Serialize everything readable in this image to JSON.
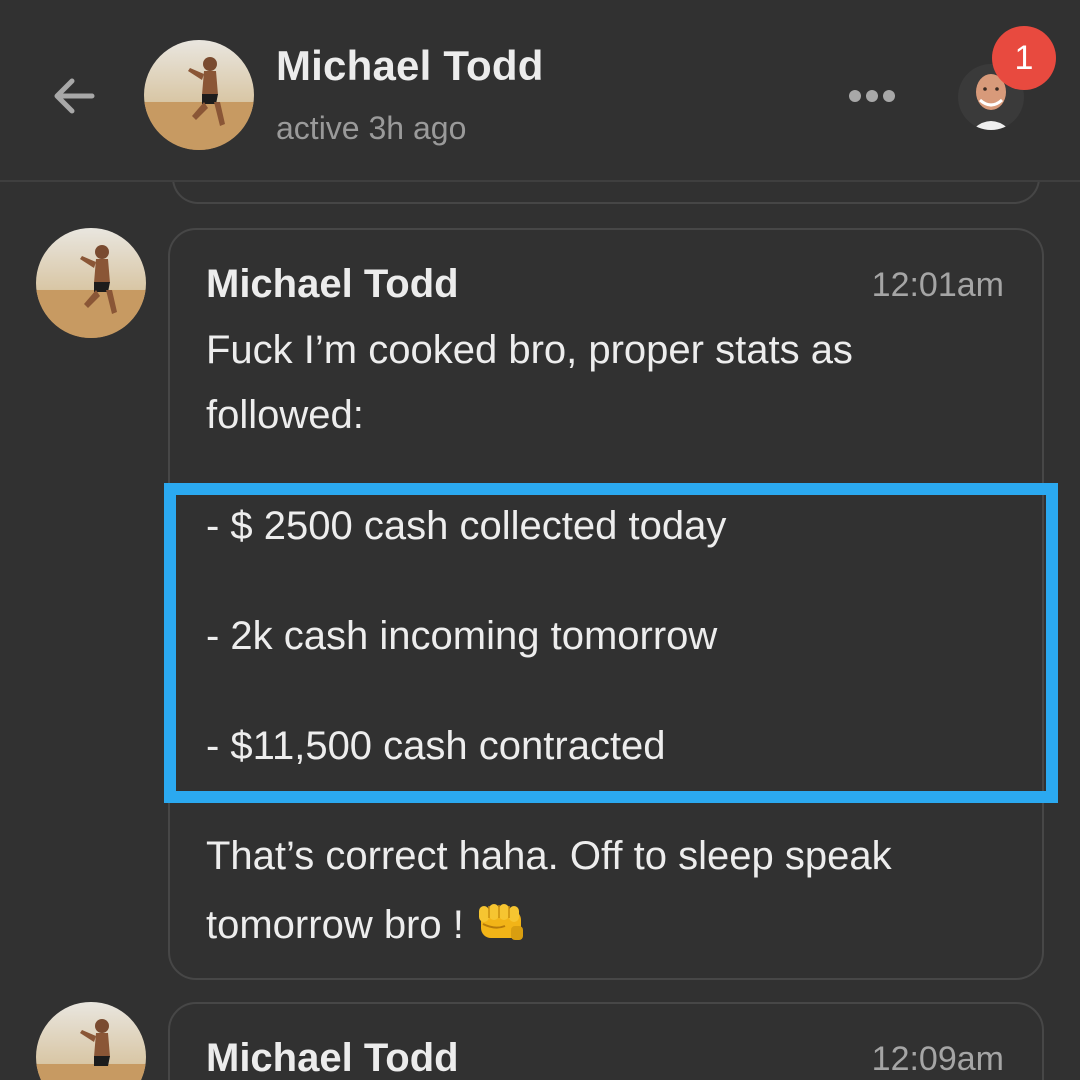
{
  "header": {
    "contact_name": "Michael Todd",
    "status": "active 3h ago",
    "notification_count": "1",
    "back_icon": "arrow-left-icon",
    "more_icon": "more-horizontal-icon"
  },
  "messages": [
    {
      "sender": "Michael Todd",
      "time": "12:01am",
      "lines": [
        "Fuck I’m cooked bro, proper stats as",
        "followed:",
        "- $ 2500 cash collected today",
        "- 2k cash incoming tomorrow",
        "- $11,500 cash contracted",
        "That’s correct haha. Off to sleep speak",
        "tomorrow bro ! "
      ],
      "emoji": "oncoming-fist"
    },
    {
      "sender": "Michael Todd",
      "time": "12:09am"
    }
  ],
  "colors": {
    "background": "#313131",
    "highlight": "#2ba9f0",
    "badge": "#e84a3f",
    "text": "#ededed",
    "muted": "#9a9a9a"
  }
}
